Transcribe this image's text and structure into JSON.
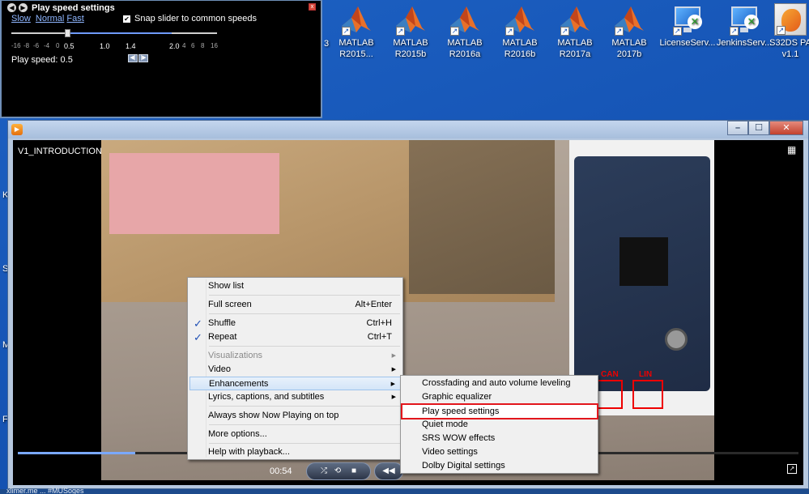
{
  "speed_window": {
    "title": "Play speed settings",
    "link_slow": "Slow",
    "link_normal": "Normal",
    "link_fast": "Fast",
    "snap_label": "Snap slider to common speeds",
    "snap_checked": true,
    "ticks": [
      "-16",
      "-8",
      "-6",
      "-4",
      "0"
    ],
    "tick_half": "0.5",
    "tick_one": "1.0",
    "tick_onefour": "1.4",
    "tick_two": "2.0",
    "ticks_right": [
      "4",
      "6",
      "8",
      "16"
    ],
    "play_speed_label": "Play speed: 0.5",
    "value": 0.5
  },
  "desktop": {
    "fragment_3": "3",
    "icons": [
      {
        "label1": "MATLAB",
        "label2": "R2015..."
      },
      {
        "label1": "MATLAB",
        "label2": "R2015b"
      },
      {
        "label1": "MATLAB",
        "label2": "R2016a"
      },
      {
        "label1": "MATLAB",
        "label2": "R2016b"
      },
      {
        "label1": "MATLAB",
        "label2": "R2017a"
      },
      {
        "label1": "MATLAB",
        "label2": "2017b"
      },
      {
        "label1": "LicenseServ...",
        "label2": ""
      },
      {
        "label1": "JenkinsServ...",
        "label2": ""
      },
      {
        "label1": "S32DS PA",
        "label2": "v1.1"
      }
    ],
    "left_letters": [
      "K",
      "S",
      "M",
      "F"
    ]
  },
  "player": {
    "video_title": "V1_INTRODUCTION",
    "time": "00:54",
    "seek_fraction": 0.15,
    "board_labels": {
      "can": "CAN",
      "lin": "LIN"
    }
  },
  "context_menu": {
    "items": [
      {
        "label": "Show list",
        "shortcut": ""
      },
      {
        "label": "Full screen",
        "shortcut": "Alt+Enter"
      },
      {
        "label": "Shuffle",
        "shortcut": "Ctrl+H"
      },
      {
        "label": "Repeat",
        "shortcut": "Ctrl+T"
      },
      {
        "label": "Visualizations",
        "shortcut": ""
      },
      {
        "label": "Video",
        "shortcut": ""
      },
      {
        "label": "Enhancements",
        "shortcut": ""
      },
      {
        "label": "Lyrics, captions, and subtitles",
        "shortcut": ""
      },
      {
        "label": "Always show Now Playing on top",
        "shortcut": ""
      },
      {
        "label": "More options...",
        "shortcut": ""
      },
      {
        "label": "Help with playback...",
        "shortcut": ""
      }
    ]
  },
  "submenu": {
    "items": [
      {
        "label": "Crossfading and auto volume leveling"
      },
      {
        "label": "Graphic equalizer"
      },
      {
        "label": "Play speed settings"
      },
      {
        "label": "Quiet mode"
      },
      {
        "label": "SRS WOW effects"
      },
      {
        "label": "Video settings"
      },
      {
        "label": "Dolby Digital settings"
      }
    ]
  },
  "taskbar": {
    "fragment": "xlimer.me ... #MUSoges"
  }
}
